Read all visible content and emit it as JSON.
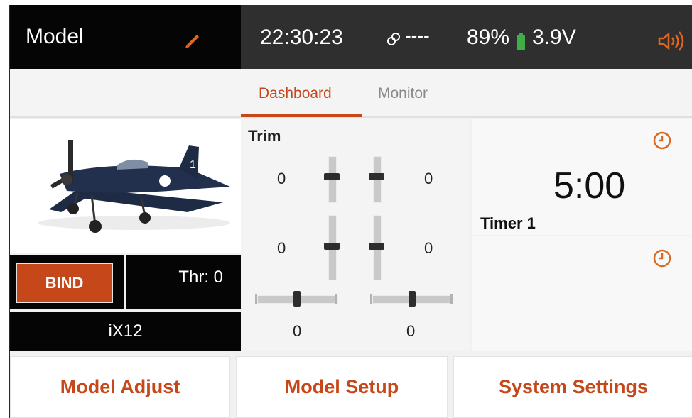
{
  "header": {
    "title": "Model",
    "time": "22:30:23",
    "link": "----",
    "battery_percent": "89%",
    "voltage": "3.9V"
  },
  "tabs": [
    {
      "label": "Dashboard",
      "active": true
    },
    {
      "label": "Monitor",
      "active": false
    }
  ],
  "left_panel": {
    "bind_label": "BIND",
    "throttle": "Thr: 0",
    "device": "iX12"
  },
  "trim": {
    "label": "Trim",
    "left_upper_value": "0",
    "right_upper_value": "0",
    "left_lower_value": "0",
    "right_lower_value": "0",
    "left_horizontal_value": "0",
    "right_horizontal_value": "0"
  },
  "timers": [
    {
      "label": "Timer 1",
      "value": "5:00"
    },
    {
      "label": "",
      "value": ""
    }
  ],
  "bottom_buttons": [
    "Model Adjust",
    "Model Setup",
    "System Settings"
  ],
  "colors": {
    "accent": "#c5471a",
    "battery": "#3fae49",
    "header_left": "#050505",
    "header_right": "#2f2f2f",
    "panel": "#f4f4f4"
  },
  "icons": [
    "pencil-icon",
    "link-icon",
    "battery-icon",
    "speaker-icon",
    "clock-icon",
    "airplane-image"
  ]
}
